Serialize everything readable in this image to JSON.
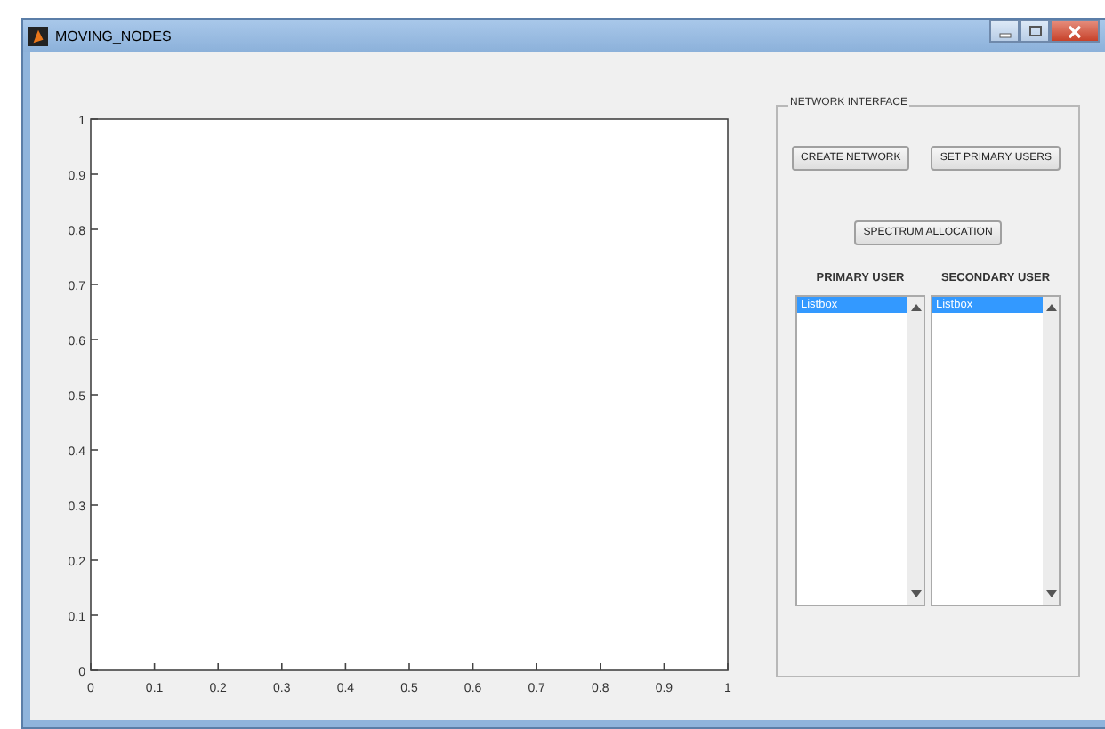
{
  "window": {
    "title": "MOVING_NODES"
  },
  "axes": {
    "chart_data": {
      "type": "line",
      "xlim": [
        0,
        1
      ],
      "ylim": [
        0,
        1
      ],
      "xticks": [
        {
          "value": 0,
          "label": "0"
        },
        {
          "value": 0.1,
          "label": "0.1"
        },
        {
          "value": 0.2,
          "label": "0.2"
        },
        {
          "value": 0.3,
          "label": "0.3"
        },
        {
          "value": 0.4,
          "label": "0.4"
        },
        {
          "value": 0.5,
          "label": "0.5"
        },
        {
          "value": 0.6,
          "label": "0.6"
        },
        {
          "value": 0.7,
          "label": "0.7"
        },
        {
          "value": 0.8,
          "label": "0.8"
        },
        {
          "value": 0.9,
          "label": "0.9"
        },
        {
          "value": 1,
          "label": "1"
        }
      ],
      "yticks": [
        {
          "value": 0,
          "label": "0"
        },
        {
          "value": 0.1,
          "label": "0.1"
        },
        {
          "value": 0.2,
          "label": "0.2"
        },
        {
          "value": 0.3,
          "label": "0.3"
        },
        {
          "value": 0.4,
          "label": "0.4"
        },
        {
          "value": 0.5,
          "label": "0.5"
        },
        {
          "value": 0.6,
          "label": "0.6"
        },
        {
          "value": 0.7,
          "label": "0.7"
        },
        {
          "value": 0.8,
          "label": "0.8"
        },
        {
          "value": 0.9,
          "label": "0.9"
        },
        {
          "value": 1,
          "label": "1"
        }
      ]
    }
  },
  "panel": {
    "title": "NETWORK INTERFACE",
    "buttons": [
      {
        "label": "CREATE NETWORK"
      },
      {
        "label": "SET PRIMARY USERS"
      },
      {
        "label": "SPECTRUM ALLOCATION"
      }
    ],
    "lists": [
      {
        "heading": "PRIMARY USER",
        "items": [
          {
            "text": "Listbox",
            "selected": true
          }
        ]
      },
      {
        "heading": "SECONDARY USER",
        "items": [
          {
            "text": "Listbox",
            "selected": true
          }
        ]
      }
    ]
  }
}
